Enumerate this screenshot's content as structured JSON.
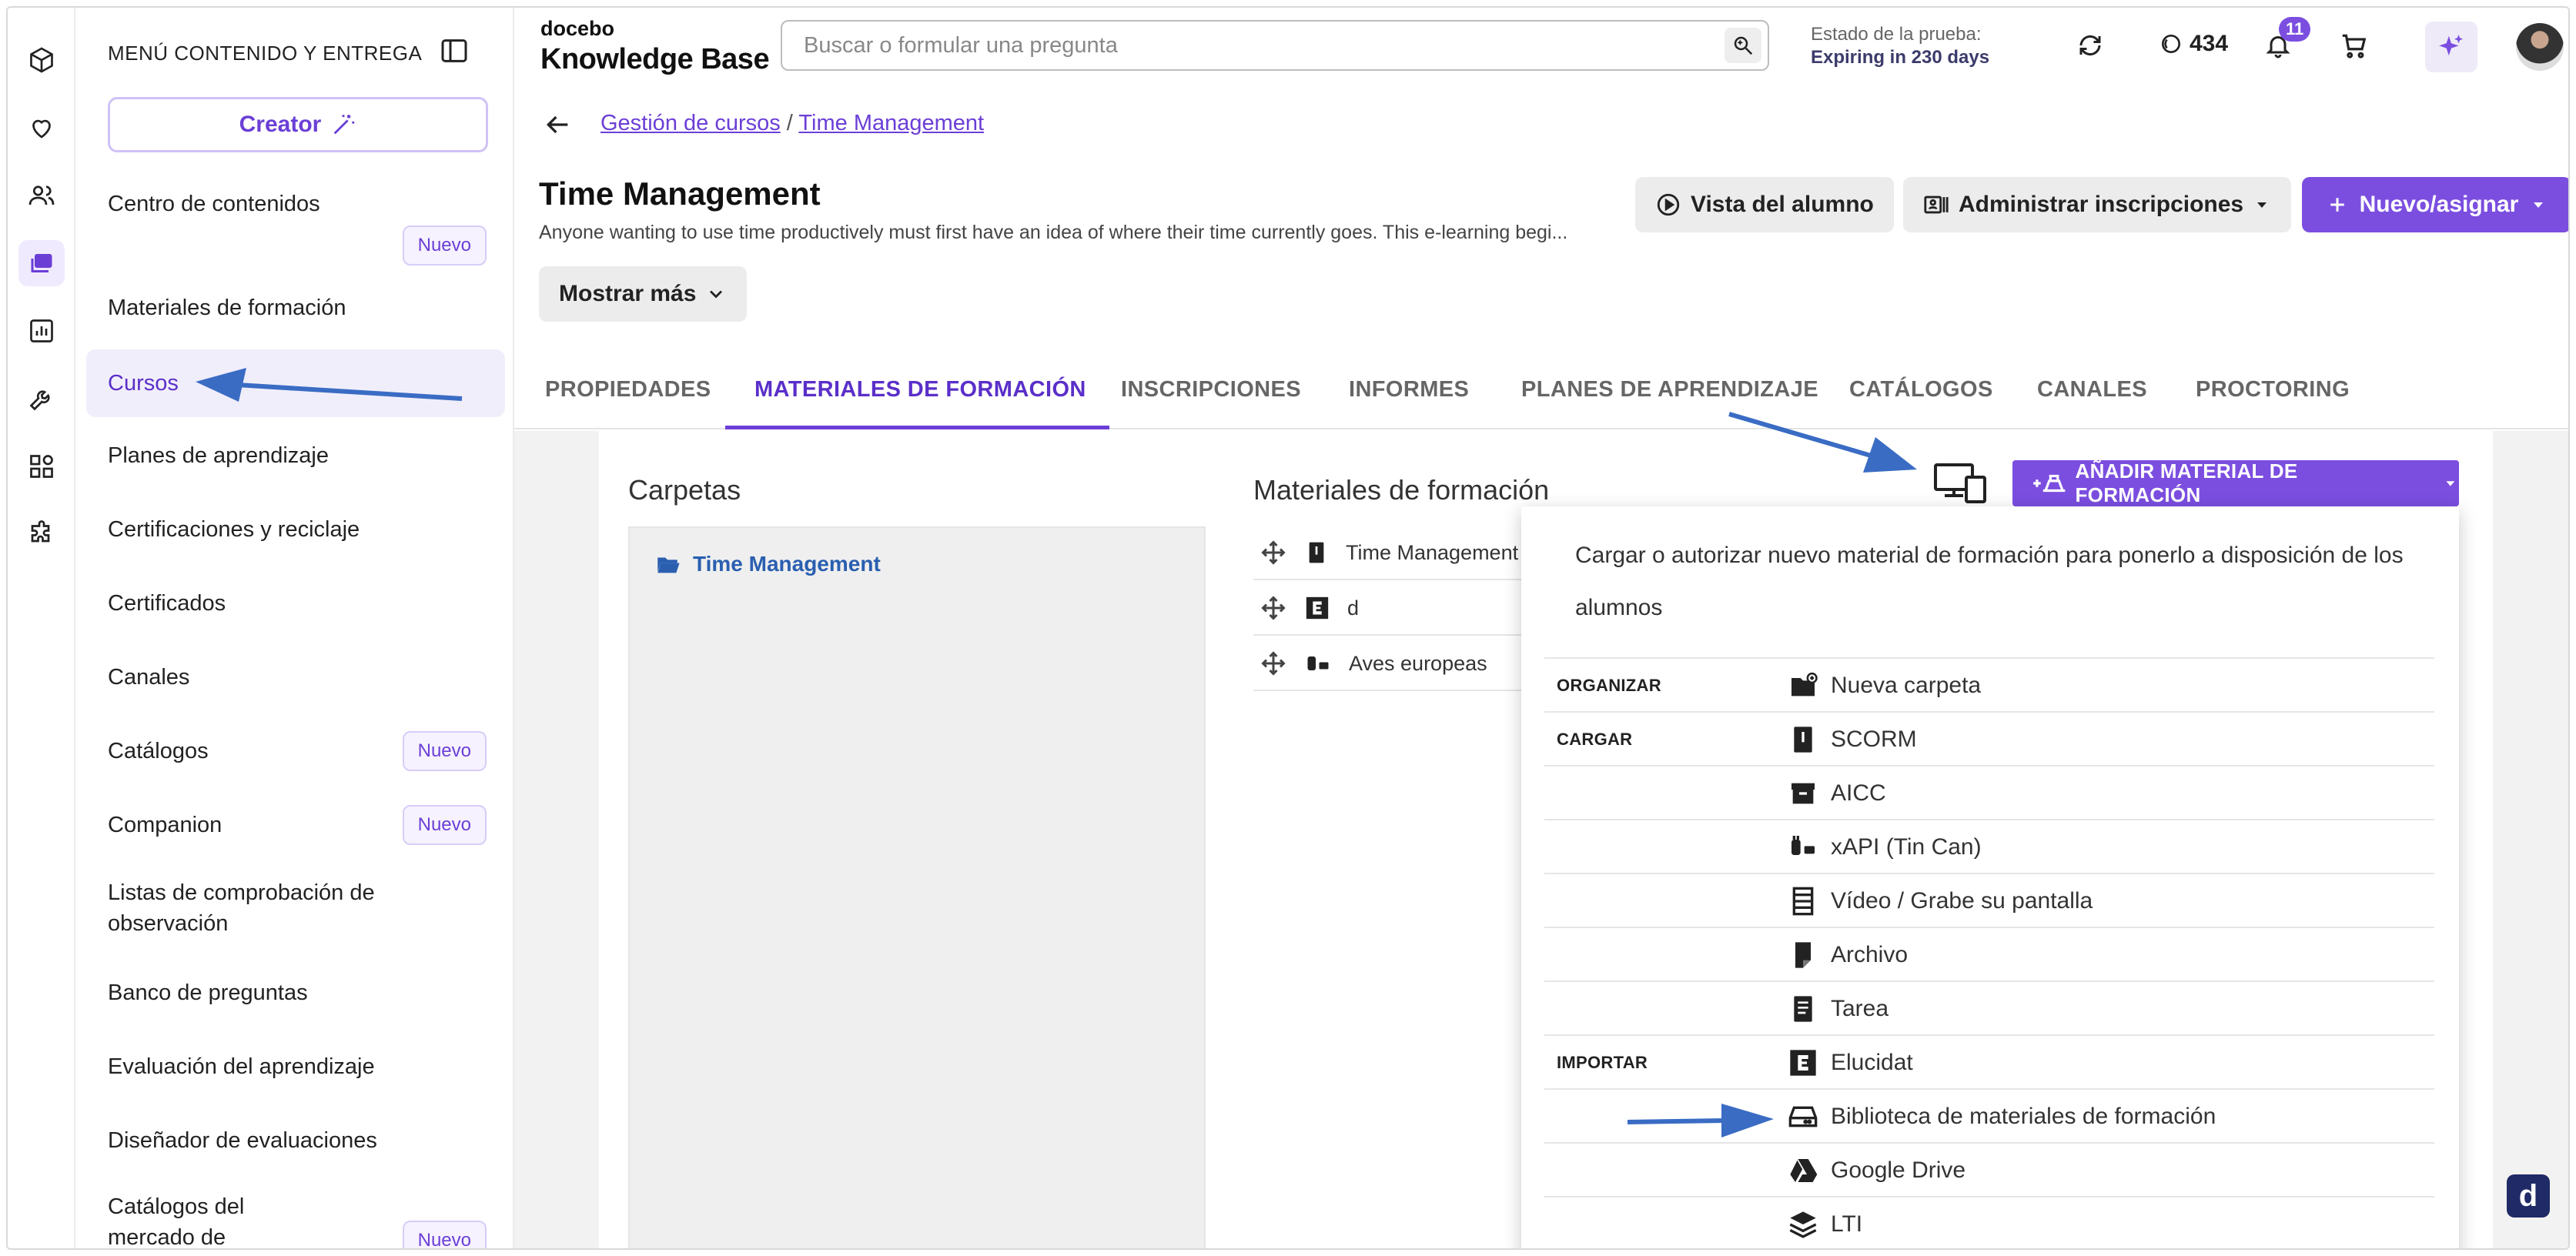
{
  "sidebar": {
    "header": "MENÚ CONTENIDO Y ENTREGA",
    "creator_label": "Creator",
    "items": [
      {
        "label": "Centro de contenidos",
        "badge": "Nuevo"
      },
      {
        "label": "Materiales de formación",
        "badge": ""
      },
      {
        "label": "Cursos",
        "badge": ""
      },
      {
        "label": "Planes de aprendizaje",
        "badge": ""
      },
      {
        "label": "Certificaciones y reciclaje",
        "badge": ""
      },
      {
        "label": "Certificados",
        "badge": ""
      },
      {
        "label": "Canales",
        "badge": ""
      },
      {
        "label": "Catálogos",
        "badge": "Nuevo"
      },
      {
        "label": "Companion",
        "badge": "Nuevo"
      },
      {
        "label": "Listas de comprobación de observación",
        "badge": ""
      },
      {
        "label": "Banco de preguntas",
        "badge": ""
      },
      {
        "label": "Evaluación del aprendizaje",
        "badge": ""
      },
      {
        "label": "Diseñador de evaluaciones",
        "badge": ""
      },
      {
        "label": "Catálogos del mercado de",
        "badge": "Nuevo"
      }
    ]
  },
  "header": {
    "brand_small": "docebo",
    "brand_big": "Knowledge Base",
    "search_placeholder": "Buscar o formular una pregunta",
    "trial_label": "Estado de la prueba:",
    "trial_value": "Expiring in 230 days",
    "credits": "434",
    "notifications": "11"
  },
  "breadcrumb": {
    "parent": "Gestión de cursos",
    "separator": "/",
    "current": "Time Management"
  },
  "course": {
    "title": "Time Management",
    "description": "Anyone wanting to use time productively must first have an idea of where their time currently goes. This e-learning begi...",
    "show_more": "Mostrar más",
    "learner_view": "Vista del alumno",
    "manage_enrollments": "Administrar inscripciones",
    "new_assign": "Nuevo/asignar"
  },
  "tabs": [
    {
      "label": "PROPIEDADES",
      "active": false
    },
    {
      "label": "MATERIALES DE FORMACIÓN",
      "active": true
    },
    {
      "label": "INSCRIPCIONES",
      "active": false
    },
    {
      "label": "INFORMES",
      "active": false
    },
    {
      "label": "PLANES DE APRENDIZAJE",
      "active": false
    },
    {
      "label": "CATÁLOGOS",
      "active": false
    },
    {
      "label": "CANALES",
      "active": false
    },
    {
      "label": "PROCTORING",
      "active": false
    }
  ],
  "content": {
    "folders_title": "Carpetas",
    "folder_name": "Time Management",
    "materials_title": "Materiales de formación",
    "materials": [
      {
        "name": "Time Management",
        "icon": "scorm-icon"
      },
      {
        "name": "d",
        "icon": "elucidat-icon"
      },
      {
        "name": "Aves europeas",
        "icon": "xapi-icon"
      }
    ],
    "add_button": "AÑADIR MATERIAL DE FORMACIÓN"
  },
  "dropdown": {
    "description": "Cargar o autorizar nuevo material de formación para ponerlo a disposición de los alumnos",
    "rows": [
      {
        "category": "ORGANIZAR",
        "label": "Nueva carpeta",
        "icon": "new-folder-icon"
      },
      {
        "category": "CARGAR",
        "label": "SCORM",
        "icon": "scorm-icon"
      },
      {
        "category": "",
        "label": "AICC",
        "icon": "aicc-icon"
      },
      {
        "category": "",
        "label": "xAPI (Tin Can)",
        "icon": "xapi-icon"
      },
      {
        "category": "",
        "label": "Vídeo / Grabe su pantalla",
        "icon": "video-icon"
      },
      {
        "category": "",
        "label": "Archivo",
        "icon": "file-icon"
      },
      {
        "category": "",
        "label": "Tarea",
        "icon": "assignment-icon"
      },
      {
        "category": "IMPORTAR",
        "label": "Elucidat",
        "icon": "elucidat-icon"
      },
      {
        "category": "",
        "label": "Biblioteca de materiales de formación",
        "icon": "library-icon"
      },
      {
        "category": "",
        "label": "Google Drive",
        "icon": "google-drive-icon"
      },
      {
        "category": "",
        "label": "LTI",
        "icon": "lti-icon"
      }
    ]
  },
  "colors": {
    "accent": "#7b4ee0",
    "accent_dark": "#5a2fc9",
    "link": "#2a5fb0",
    "annotation_arrow": "#3a6cc4"
  }
}
